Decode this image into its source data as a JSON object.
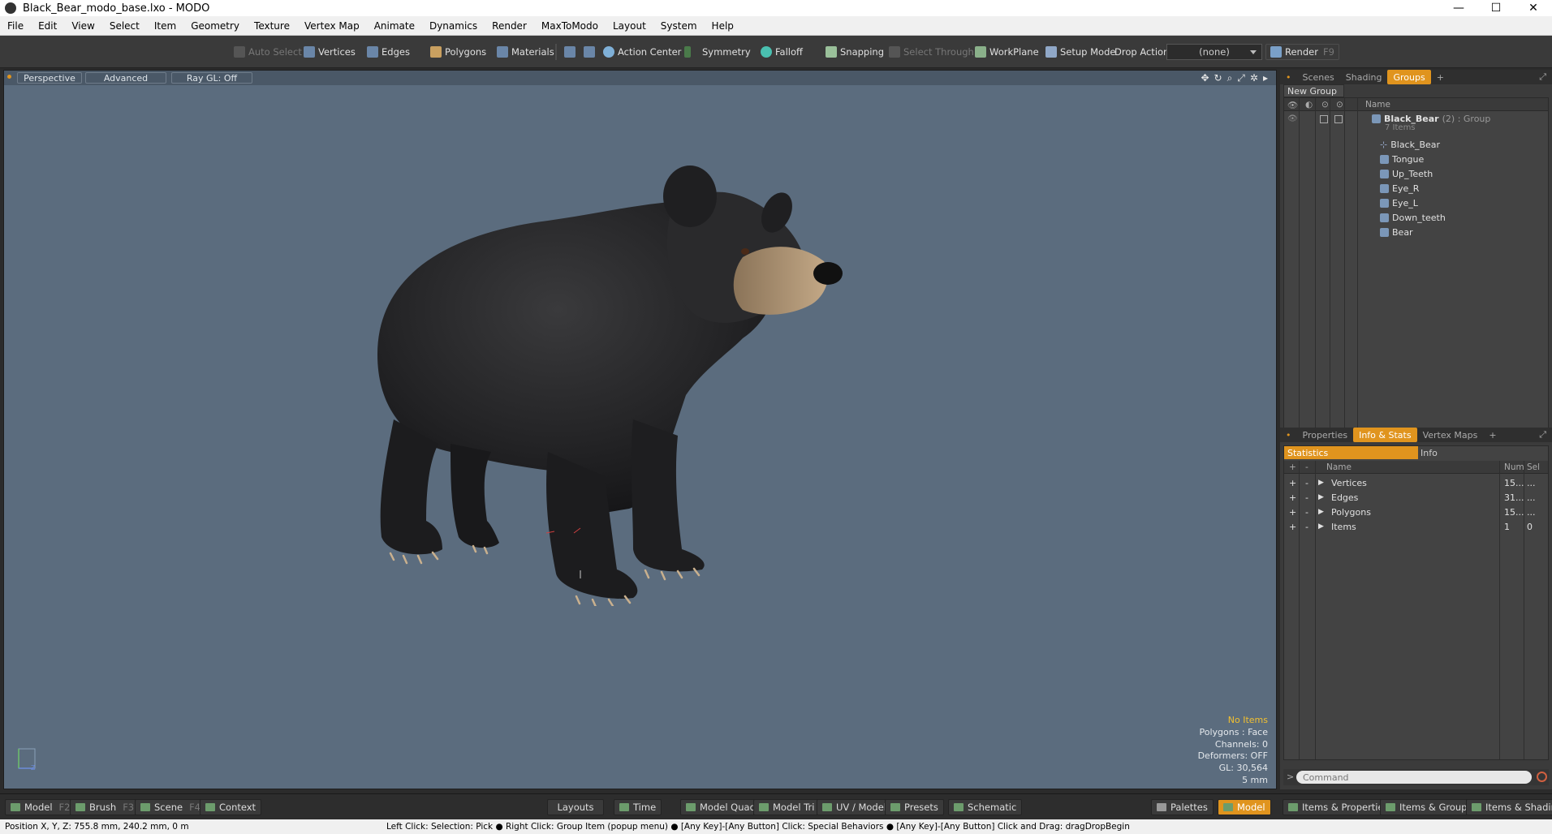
{
  "window": {
    "title": "Black_Bear_modo_base.lxo - MODO",
    "minimize": "—",
    "maximize": "☐",
    "close": "✕"
  },
  "menu": [
    "File",
    "Edit",
    "View",
    "Select",
    "Item",
    "Geometry",
    "Texture",
    "Vertex Map",
    "Animate",
    "Dynamics",
    "Render",
    "MaxToModo",
    "Layout",
    "System",
    "Help"
  ],
  "toolbar": {
    "auto_select": "Auto Select",
    "vertices": "Vertices",
    "edges": "Edges",
    "polygons": "Polygons",
    "materials": "Materials",
    "action_center": "Action Center",
    "symmetry": "Symmetry",
    "falloff": "Falloff",
    "snapping": "Snapping",
    "select_through": "Select Through",
    "workplane": "WorkPlane",
    "setup_mode": "Setup Mode",
    "drop_action": "Drop Action",
    "drop_value": "(none)",
    "render": "Render",
    "render_key": "F9"
  },
  "viewport": {
    "tabs": [
      "Perspective",
      "Advanced",
      "Ray GL: Off"
    ],
    "stats": [
      "No Items",
      "Polygons : Face",
      "Channels: 0",
      "Deformers: OFF",
      "GL: 30,564",
      "5 mm"
    ]
  },
  "groups_panel": {
    "tabs": [
      "Scenes",
      "Shading",
      "Groups",
      "+"
    ],
    "new_group": "New Group",
    "name_header": "Name",
    "group_name": "Black_Bear",
    "group_suffix": "(2) : Group",
    "group_count": "7 Items",
    "items": [
      "Black_Bear",
      "Tongue",
      "Up_Teeth",
      "Eye_R",
      "Eye_L",
      "Down_teeth",
      "Bear"
    ]
  },
  "info_panel": {
    "tabs": [
      "Properties",
      "Info & Stats",
      "Vertex Maps",
      "+"
    ],
    "statistics": "Statistics",
    "info": "Info",
    "cols": {
      "plus": "+",
      "minus": "-",
      "name": "Name",
      "num": "Num",
      "sel": "Sel"
    },
    "rows": [
      {
        "name": "Vertices",
        "num": "15...",
        "sel": "..."
      },
      {
        "name": "Edges",
        "num": "31...",
        "sel": "..."
      },
      {
        "name": "Polygons",
        "num": "15...",
        "sel": "..."
      },
      {
        "name": "Items",
        "num": "1",
        "sel": "0"
      }
    ],
    "command_placeholder": "Command"
  },
  "bottom": {
    "model": "Model",
    "model_key": "F2",
    "brush": "Brush",
    "brush_key": "F3",
    "scene": "Scene",
    "scene_key": "F4",
    "context": "Context",
    "layouts": "Layouts",
    "time": "Time",
    "model_quad": "Model Quad",
    "model_tri": "Model Tri",
    "uv_model": "UV / Model",
    "presets": "Presets",
    "schematic": "Schematic",
    "palettes": "Palettes",
    "model_active": "Model",
    "items_properties": "Items & Properties",
    "items_groups": "Items & Groups",
    "items_shading": "Items & Shading"
  },
  "status": {
    "position": "Position X, Y, Z:   755.8 mm, 240.2 mm, 0 m",
    "hint": "Left Click: Selection: Pick ● Right Click: Group Item (popup menu) ● [Any Key]-[Any Button] Click: Special Behaviors ● [Any Key]-[Any Button] Click and Drag: dragDropBegin"
  },
  "colors": {
    "accent": "#e0941e",
    "viewport_bg": "#5b6c7e",
    "stats_highlight": "#f2c030"
  }
}
